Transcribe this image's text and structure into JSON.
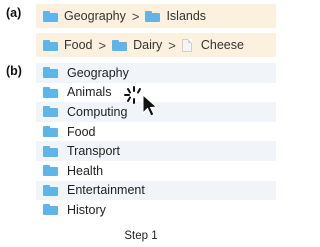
{
  "labels": {
    "a": "(a)",
    "b": "(b)"
  },
  "breadcrumbs": {
    "path1": [
      "Geography",
      "Islands"
    ],
    "path2": [
      "Food",
      "Dairy",
      "Cheese"
    ],
    "separator": ">"
  },
  "folders": [
    "Geography",
    "Animals",
    "Computing",
    "Food",
    "Transport",
    "Health",
    "Entertainment",
    "History"
  ],
  "caption": "Step 1",
  "icons": {
    "folder": "folder-icon",
    "file": "file-icon",
    "cursor": "busy-pointer-cursor"
  },
  "colors": {
    "breadcrumb_bg": "#fcf1de",
    "folder": "#5fb4ea",
    "row_stripe": "#f1f5fa"
  }
}
